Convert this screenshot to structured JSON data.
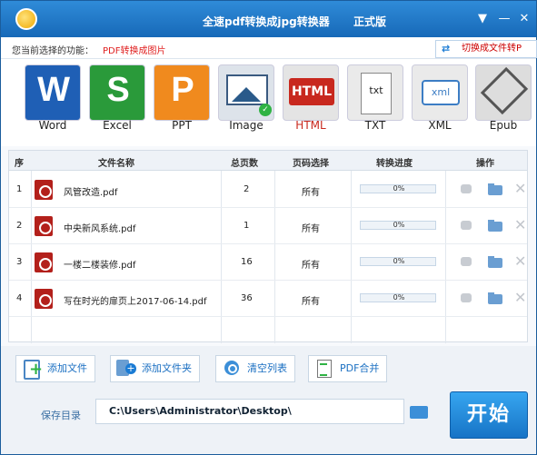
{
  "app": {
    "title": "全速pdf转换成jpg转换器",
    "edition": "正式版"
  },
  "current": {
    "label": "您当前选择的功能：",
    "value": "PDF转换成图片"
  },
  "switch": {
    "label": "切换成文件转P"
  },
  "formats": [
    {
      "label": "Word",
      "glyph": "W"
    },
    {
      "label": "Excel",
      "glyph": "S"
    },
    {
      "label": "PPT",
      "glyph": "P"
    },
    {
      "label": "Image",
      "glyph": "images"
    },
    {
      "label": "HTML",
      "glyph": "HTML"
    },
    {
      "label": "TXT",
      "glyph": "txt"
    },
    {
      "label": "XML",
      "glyph": "xml"
    },
    {
      "label": "Epub",
      "glyph": ""
    }
  ],
  "table": {
    "headers": [
      "序",
      "文件名称",
      "总页数",
      "页码选择",
      "转换进度",
      "操作"
    ],
    "rows": [
      {
        "num": "1",
        "name": "风管改造.pdf",
        "pages": "2",
        "range": "所有",
        "progress": "0%"
      },
      {
        "num": "2",
        "name": "中央新风系统.pdf",
        "pages": "1",
        "range": "所有",
        "progress": "0%"
      },
      {
        "num": "3",
        "name": "一楼二楼装修.pdf",
        "pages": "16",
        "range": "所有",
        "progress": "0%"
      },
      {
        "num": "4",
        "name": "写在时光的扉页上2017-06-14.pdf",
        "pages": "36",
        "range": "所有",
        "progress": "0%"
      }
    ]
  },
  "actions": {
    "add_file": "添加文件",
    "add_folder": "添加文件夹",
    "clear": "清空列表",
    "merge": "PDF合并"
  },
  "save": {
    "label": "保存目录",
    "path": "C:\\Users\\Administrator\\Desktop\\"
  },
  "start": {
    "label": "开始"
  },
  "colors": {
    "title_bar": "#1f78c8",
    "accent_red": "#e02020",
    "start_button": "#2a8fe0"
  }
}
